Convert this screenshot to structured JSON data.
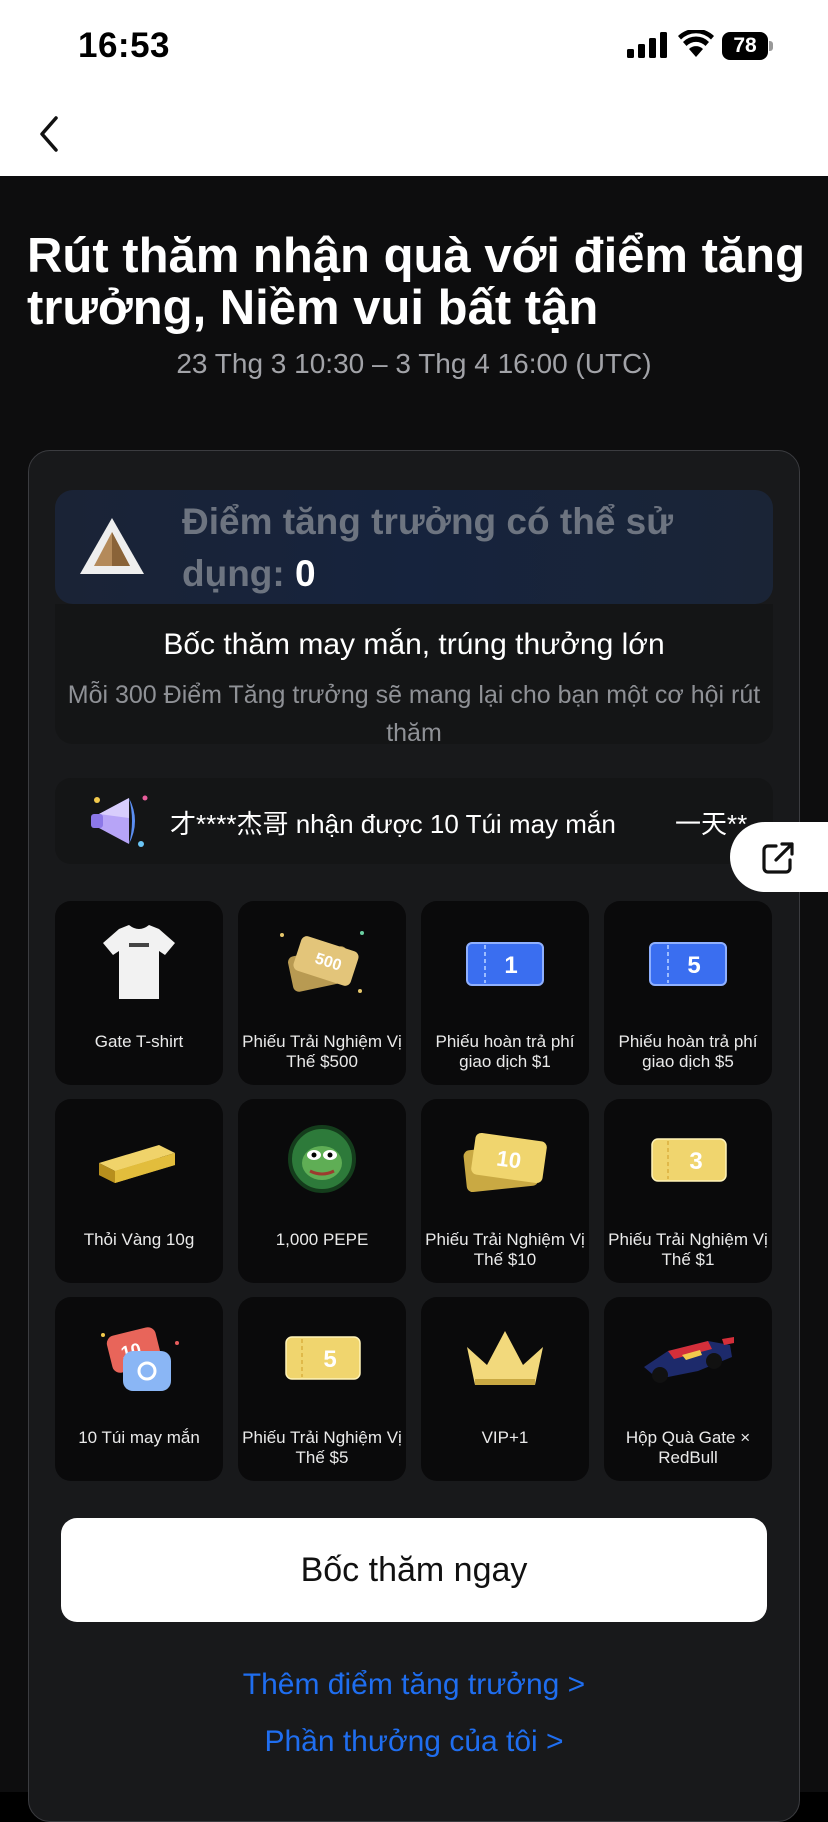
{
  "status_bar": {
    "time": "16:53",
    "battery": "78"
  },
  "header": {
    "title": "Rút thăm nhận quà với điểm tăng trưởng, Niềm vui bất tận",
    "dates": "23 Thg 3 10:30 – 3 Thg 4 16:00 (UTC)"
  },
  "points": {
    "label": "Điểm tăng trưởng có thể sử dụng:",
    "value": "0"
  },
  "draw": {
    "title": "Bốc thăm may mắn, trúng thưởng lớn",
    "subtitle": "Mỗi 300 Điểm Tăng trưởng sẽ mang lại cho bạn một cơ hội rút thăm"
  },
  "ticker": {
    "message": "才****杰哥 nhận được 10 Túi may mắn",
    "next": "一天**"
  },
  "prizes": [
    {
      "label": "Gate T-shirt",
      "icon": "tshirt-icon"
    },
    {
      "label": "Phiếu Trải Nghiệm Vị Thế $500",
      "icon": "voucher-500-icon"
    },
    {
      "label": "Phiếu hoàn trả phí giao dịch $1",
      "icon": "rebate-ticket-1-icon"
    },
    {
      "label": "Phiếu hoàn trả phí giao dịch $5",
      "icon": "rebate-ticket-5-icon"
    },
    {
      "label": "Thỏi Vàng 10g",
      "icon": "gold-bar-icon"
    },
    {
      "label": "1,000 PEPE",
      "icon": "pepe-coin-icon"
    },
    {
      "label": "Phiếu Trải Nghiệm Vị Thế $10",
      "icon": "voucher-10-icon"
    },
    {
      "label": "Phiếu Trải Nghiệm Vị Thế $1",
      "icon": "voucher-3-icon"
    },
    {
      "label": "10 Túi may mắn",
      "icon": "lucky-bag-icon"
    },
    {
      "label": "Phiếu Trải Nghiệm Vị Thế $5",
      "icon": "voucher-5-icon"
    },
    {
      "label": "VIP+1",
      "icon": "crown-icon"
    },
    {
      "label": "Hộp Quà Gate × RedBull",
      "icon": "race-car-icon"
    }
  ],
  "icon_texts": {
    "v500": "500",
    "t1": "1",
    "t5": "5",
    "v10": "10",
    "v3": "3",
    "bag": "10",
    "v5": "5"
  },
  "cta_label": "Bốc thăm ngay",
  "links": {
    "add_points": "Thêm điểm tăng trưởng  >",
    "my_rewards": "Phần thưởng của tôi  >"
  },
  "colors": {
    "link": "#1f6ef0",
    "gold": "#f0d36a",
    "blue_ticket": "#3a6ef0"
  }
}
